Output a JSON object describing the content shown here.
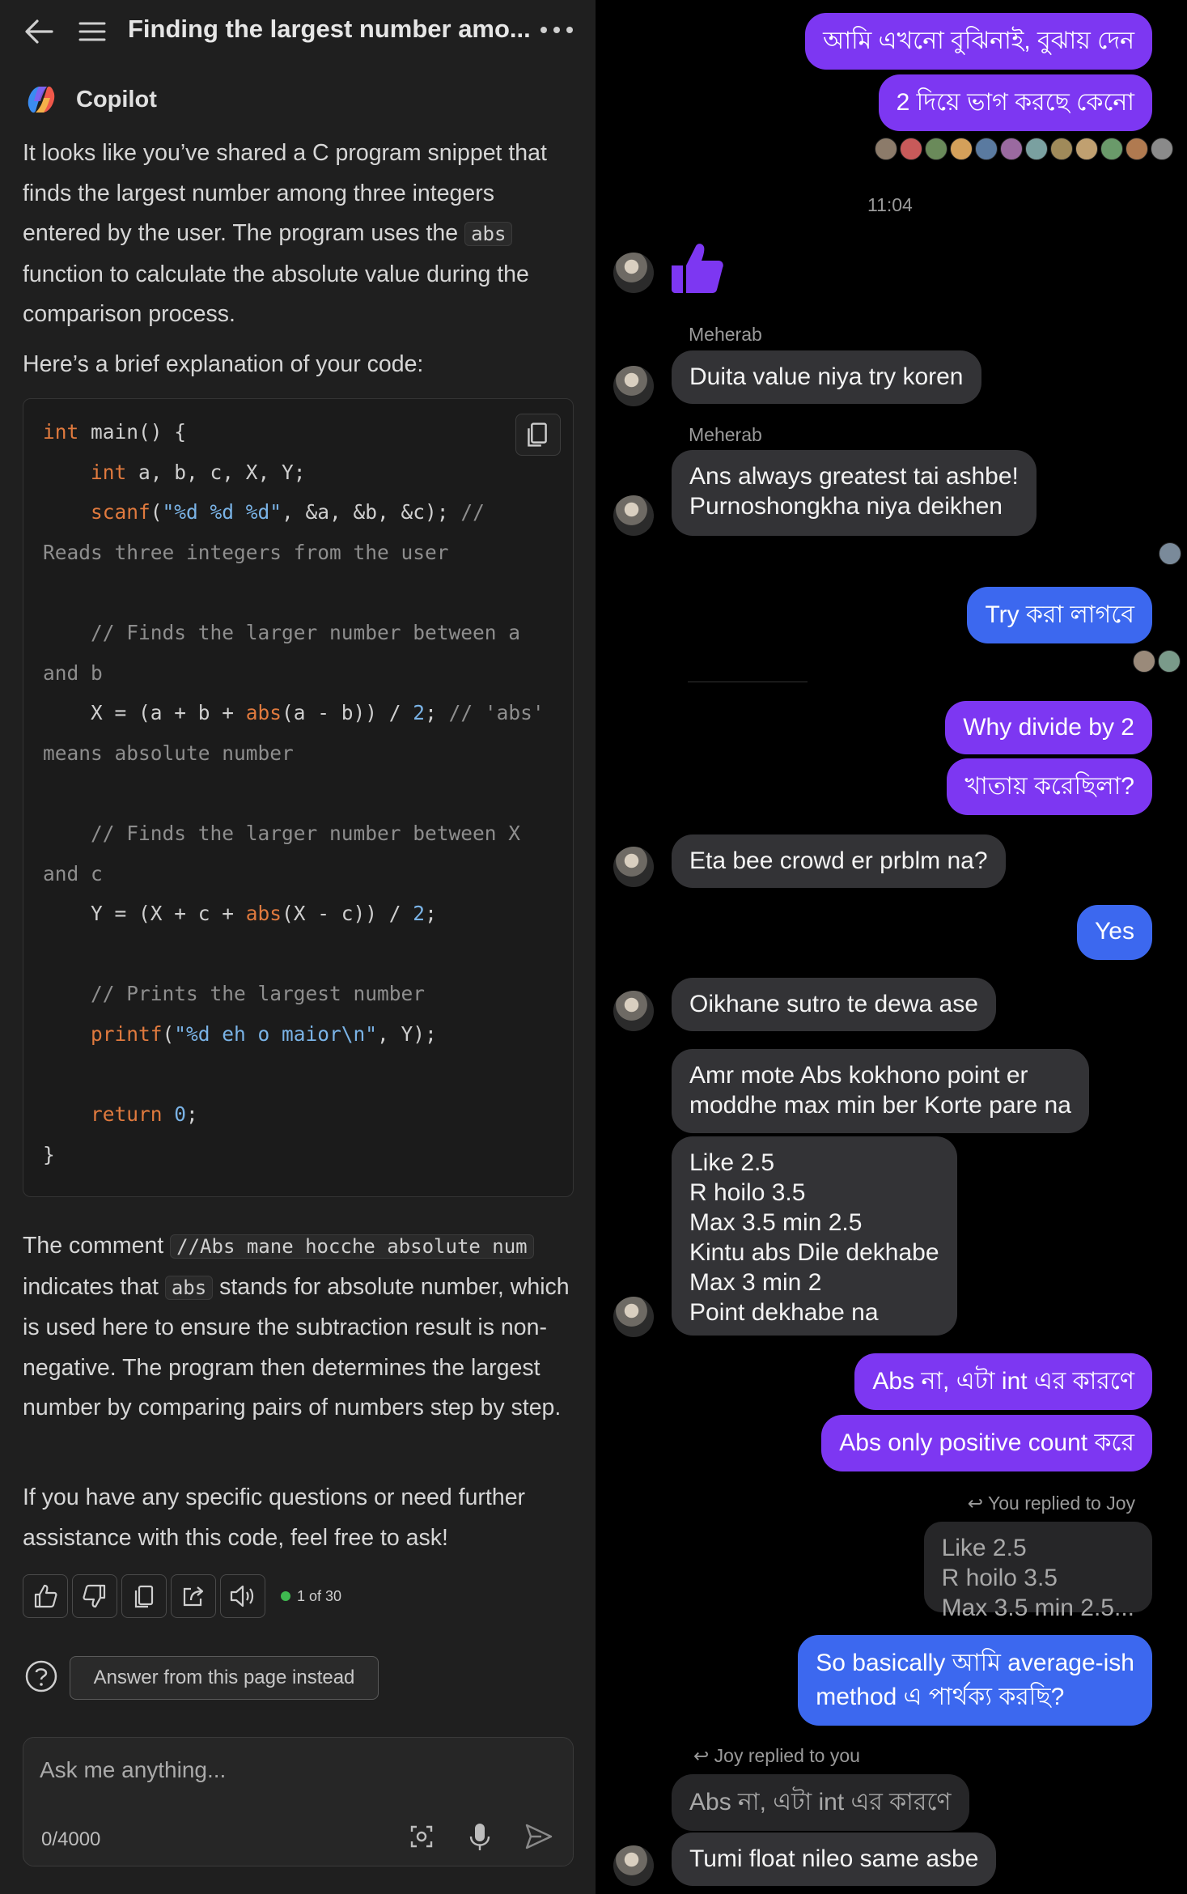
{
  "left": {
    "header": {
      "title": "Finding the largest number amo...",
      "back_icon": "arrow-left-icon",
      "menu_icon": "hamburger-icon",
      "more_icon": "more-horizontal-icon"
    },
    "brand": {
      "name": "Copilot"
    },
    "intro": {
      "p1a": "It looks like you’ve shared a C program snippet that finds the largest number among three integers entered by the user. The program uses the ",
      "p1code": "abs",
      "p1b": " function to calculate the absolute value during the comparison process.",
      "p2": "Here’s a brief explanation of your code:"
    },
    "code": {
      "l1a": "int",
      "l1b": " main() {",
      "l2a": "    int",
      "l2b": " a, b, c, X, Y;",
      "l3a": "    scanf",
      "l3b": "(",
      "l3c": "\"%d %d %d\"",
      "l3d": ", &a, &b, &c); ",
      "l3e": "//",
      "l4": "Reads three integers from the user",
      "l6": "    // Finds the larger number between a",
      "l7": "and b",
      "l8a": "    X = (a + b + ",
      "l8b": "abs",
      "l8c": "(a - b)) / ",
      "l8d": "2",
      "l8e": "; ",
      "l8f": "// 'abs'",
      "l9": "means absolute number",
      "l11": "    // Finds the larger number between X",
      "l12": "and c",
      "l13a": "    Y = (X + c + ",
      "l13b": "abs",
      "l13c": "(X - c)) / ",
      "l13d": "2",
      "l13e": ";",
      "l15": "    // Prints the largest number",
      "l16a": "    printf",
      "l16b": "(",
      "l16c": "\"%d eh o maior\\n\"",
      "l16d": ", Y);",
      "l18a": "    return",
      "l18b": " ",
      "l18c": "0",
      "l18d": ";",
      "l19": "}"
    },
    "explain": {
      "p3a": "The comment ",
      "p3code": "//Abs mane hocche absolute num",
      "p3b": " indicates that ",
      "p3code2": "abs",
      "p3c": " stands for absolute number, which is used here to ensure the subtraction result is non-negative. The program then determines the largest number by comparing pairs of numbers step by step.",
      "p4": "If you have any specific questions or need further assistance with this code, feel free to ask!"
    },
    "actions": {
      "icons": [
        "thumbs-up-icon",
        "thumbs-down-icon",
        "copy-icon",
        "share-icon",
        "speaker-icon"
      ],
      "counter": "1 of 30"
    },
    "answer_button": "Answer from this page instead",
    "input": {
      "placeholder": "Ask me anything...",
      "counter": "0/4000"
    }
  },
  "right": {
    "msgs": {
      "m1": "আমি এখনো বুঝিনাই, বুঝায় দেন",
      "m2": "2 দিয়ে ভাগ করছে কেনো",
      "time": "11:04",
      "sender1": "Meherab",
      "m3": "Duita value niya try koren",
      "sender2": "Meherab",
      "m4a": "Ans always greatest tai ashbe!",
      "m4b": "Purnoshongkha niya deikhen",
      "m5": "Try করা লাগবে",
      "m6": "Why divide by 2",
      "m7": "খাতায় করেছিলা?",
      "m8": "Eta bee crowd er prblm na?",
      "m9": "Yes",
      "m10": "Oikhane sutro te dewa ase",
      "m11a": "Amr mote Abs kokhono point er",
      "m11b": "moddhe max min ber Korte pare na",
      "m12a": "Like 2.5",
      "m12b": "R hoilo 3.5",
      "m12c": "Max 3.5 min 2.5",
      "m12d": "Kintu abs Dile dekhabe",
      "m12e": "Max 3 min 2",
      "m12f": "Point dekhabe na",
      "m13": "Abs না, এটা int এর কারণে",
      "m14": "Abs only positive count করে",
      "reply1": "↩ You replied to Joy",
      "q1a": "Like 2.5",
      "q1b": "R hoilo 3.5",
      "q1c": "Max 3.5 min 2.5...",
      "m15a": "So basically আমি average-ish",
      "m15b": "method এ পার্থক্য করছি?",
      "reply2": "↩ Joy replied to you",
      "q2": "Abs না, এটা int এর কারণে",
      "m16": "Tumi float nileo same asbe"
    },
    "thumb_icon": "thumbs-up-icon",
    "colors": {
      "my_bubble": "#7d37f2",
      "my_bubble_blue": "#3c68ef",
      "their_bubble": "#333336"
    }
  }
}
